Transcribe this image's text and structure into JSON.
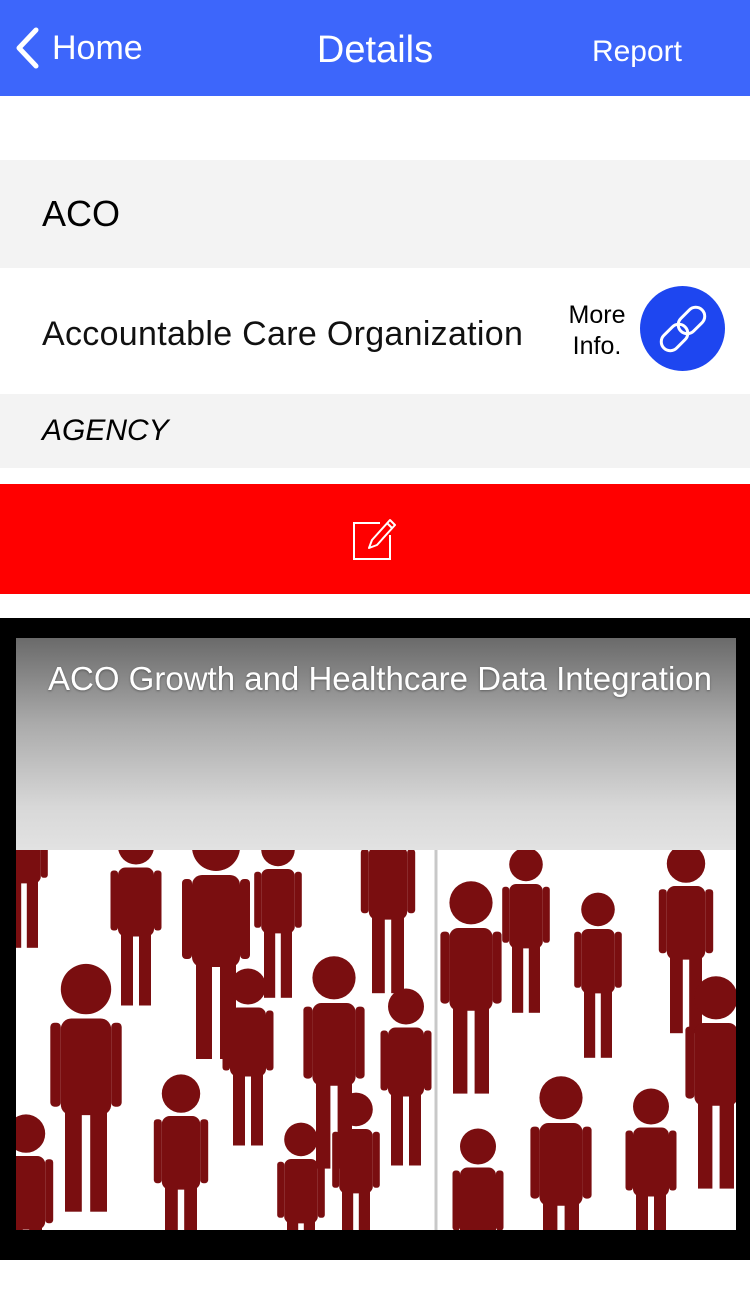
{
  "nav": {
    "back_label": "Home",
    "title": "Details",
    "report_label": "Report",
    "bar_color": "#3d66fb"
  },
  "term": {
    "acronym": "ACO",
    "definition": "Accountable Care Organization",
    "more_info_line1": "More",
    "more_info_line2": "Info.",
    "category": "AGENCY"
  },
  "edit": {
    "icon": "edit-square-icon",
    "bar_color": "#ff0000"
  },
  "video": {
    "title": "ACO Growth and Healthcare Data Integration",
    "figure_color": "#7a0e10"
  },
  "icons": {
    "back": "chevron-left-icon",
    "link": "link-chain-icon"
  }
}
